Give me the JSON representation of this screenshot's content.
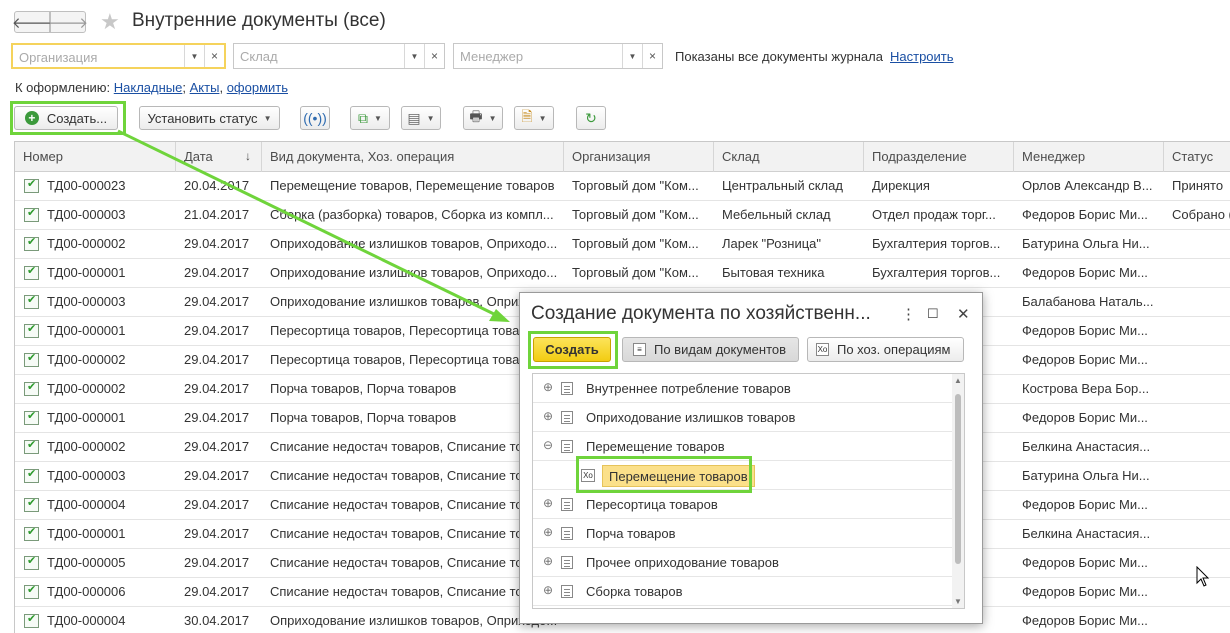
{
  "window": {
    "title": "Внутренние документы (все)"
  },
  "filters": {
    "organization_placeholder": "Организация",
    "warehouse_placeholder": "Склад",
    "manager_placeholder": "Менеджер",
    "info": "Показаны все документы журнала",
    "configure_link": "Настроить"
  },
  "forform": {
    "label": "К оформлению:",
    "link_invoices": "Накладные",
    "sep1": ";",
    "link_acts": "Акты",
    "sep2": ",",
    "link_process": "оформить"
  },
  "toolbar": {
    "create_label": "Создать...",
    "set_status_label": "Установить статус"
  },
  "table": {
    "columns": [
      "Номер",
      "Дата",
      "Вид документа, Хоз. операция",
      "Организация",
      "Склад",
      "Подразделение",
      "Менеджер",
      "Статус"
    ],
    "sort_indicator": "↓",
    "rows": [
      [
        "ТД00-000023",
        "20.04.2017",
        "Перемещение товаров, Перемещение товаров",
        "Торговый дом \"Ком...",
        "Центральный склад",
        "Дирекция",
        "Орлов Александр В...",
        "Принято"
      ],
      [
        "ТД00-000003",
        "21.04.2017",
        "Сборка (разборка) товаров, Сборка из компл...",
        "Торговый дом \"Ком...",
        "Мебельный склад",
        "Отдел продаж торг...",
        "Федоров Борис Ми...",
        "Собрано (..."
      ],
      [
        "ТД00-000002",
        "29.04.2017",
        "Оприходование излишков товаров, Оприходо...",
        "Торговый дом \"Ком...",
        "Ларек \"Розница\"",
        "Бухгалтерия торгов...",
        "Батурина Ольга Ни...",
        ""
      ],
      [
        "ТД00-000001",
        "29.04.2017",
        "Оприходование излишков товаров, Оприходо...",
        "Торговый дом \"Ком...",
        "Бытовая техника",
        "Бухгалтерия торгов...",
        "Федоров Борис Ми...",
        ""
      ],
      [
        "ТД00-000003",
        "29.04.2017",
        "Оприходование излишков товаров, Оприходо...",
        "",
        "",
        "",
        "Балабанова Наталь...",
        ""
      ],
      [
        "ТД00-000001",
        "29.04.2017",
        "Пересортица товаров, Пересортица товаров",
        "",
        "",
        "",
        "Федоров Борис Ми...",
        ""
      ],
      [
        "ТД00-000002",
        "29.04.2017",
        "Пересортица товаров, Пересортица товаров",
        "",
        "",
        "",
        "Федоров Борис Ми...",
        ""
      ],
      [
        "ТД00-000002",
        "29.04.2017",
        "Порча товаров, Порча товаров",
        "",
        "",
        "",
        "Кострова Вера Бор...",
        ""
      ],
      [
        "ТД00-000001",
        "29.04.2017",
        "Порча товаров, Порча товаров",
        "",
        "",
        "",
        "Федоров Борис Ми...",
        ""
      ],
      [
        "ТД00-000002",
        "29.04.2017",
        "Списание недостач товаров, Списание товаров",
        "",
        "",
        "",
        "Белкина Анастасия...",
        ""
      ],
      [
        "ТД00-000003",
        "29.04.2017",
        "Списание недостач товаров, Списание товаров",
        "",
        "",
        "",
        "Батурина Ольга Ни...",
        ""
      ],
      [
        "ТД00-000004",
        "29.04.2017",
        "Списание недостач товаров, Списание товаров",
        "",
        "",
        "",
        "Федоров Борис Ми...",
        ""
      ],
      [
        "ТД00-000001",
        "29.04.2017",
        "Списание недостач товаров, Списание товаров",
        "",
        "",
        "",
        "Белкина Анастасия...",
        ""
      ],
      [
        "ТД00-000005",
        "29.04.2017",
        "Списание недостач товаров, Списание товаров",
        "",
        "",
        "",
        "Федоров Борис Ми...",
        ""
      ],
      [
        "ТД00-000006",
        "29.04.2017",
        "Списание недостач товаров, Списание товаров",
        "",
        "",
        "",
        "Федоров Борис Ми...",
        ""
      ],
      [
        "ТД00-000004",
        "30.04.2017",
        "Оприходование излишков товаров, Оприходо...",
        "",
        "",
        "",
        "Федоров Борис Ми...",
        ""
      ]
    ]
  },
  "dialog": {
    "title": "Создание документа по хозяйственн...",
    "menu_icon": "⋮",
    "maximize_icon": "☐",
    "close_icon": "✕",
    "create_label": "Создать",
    "by_type_label": "По видам документов",
    "by_op_label": "По хоз. операциям",
    "op_icon_text": "Xo",
    "tree": [
      {
        "label": "Внутреннее потребление товаров",
        "expander": "⊕"
      },
      {
        "label": "Оприходование излишков товаров",
        "expander": "⊕"
      },
      {
        "label": "Перемещение товаров",
        "expander": "⊖"
      },
      {
        "label": "Перемещение товаров",
        "child": true
      },
      {
        "label": "Пересортица товаров",
        "expander": "⊕"
      },
      {
        "label": "Порча товаров",
        "expander": "⊕"
      },
      {
        "label": "Прочее оприходование товаров",
        "expander": "⊕"
      },
      {
        "label": "Сборка товаров",
        "expander": "⊕"
      }
    ]
  },
  "colors": {
    "highlight": "#6fd43b",
    "accent_yellow": "#f2cc12",
    "link": "#1a4fa3"
  }
}
